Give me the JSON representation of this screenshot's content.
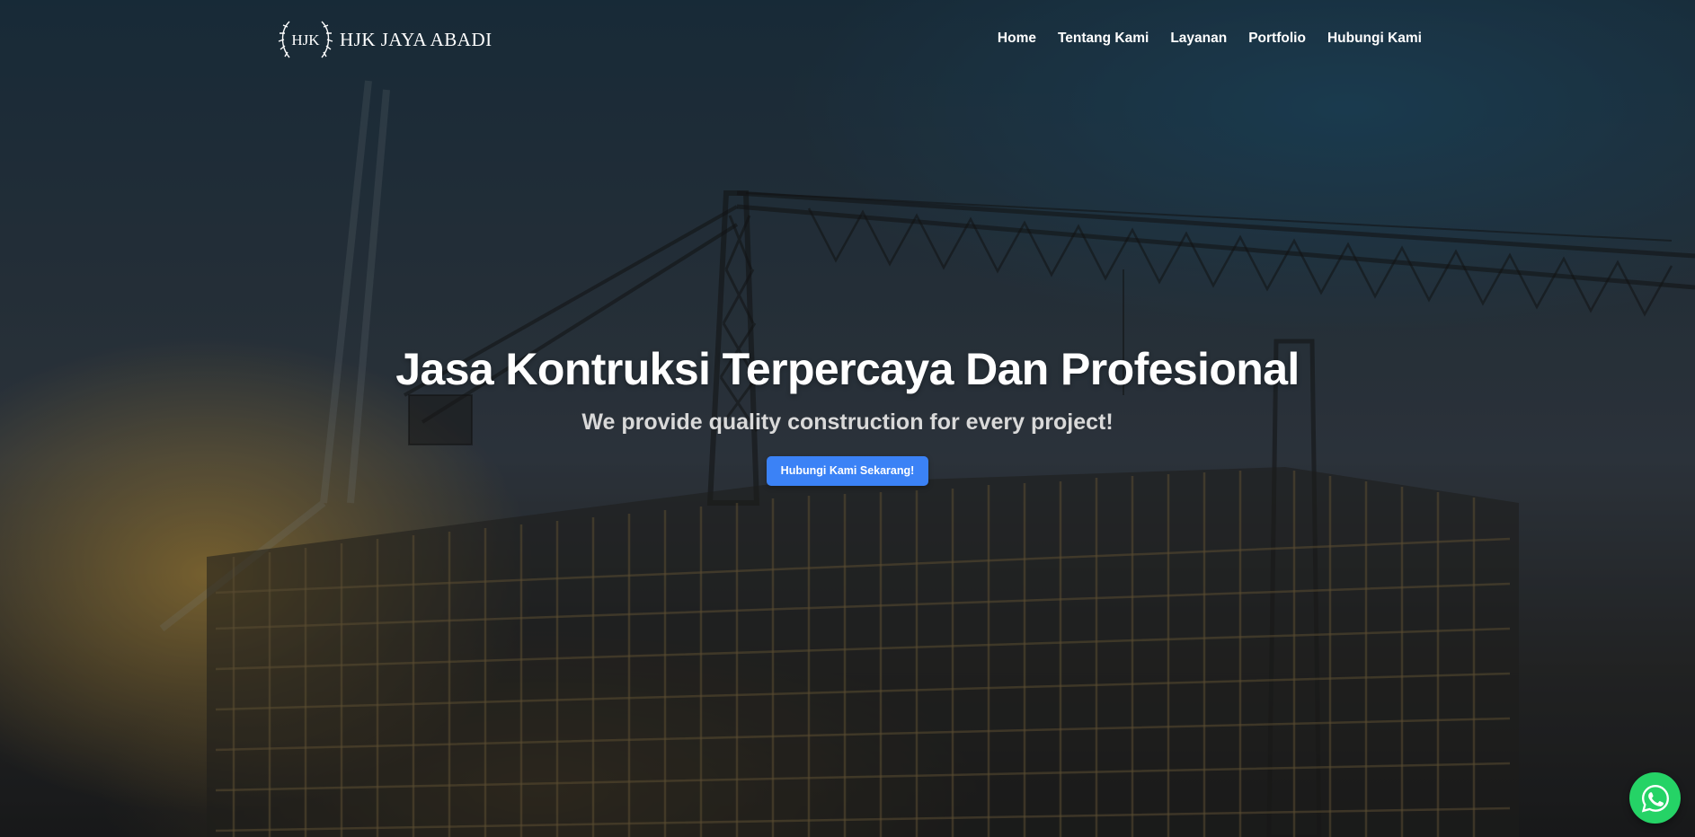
{
  "brand": {
    "logo_monogram": "HJK",
    "name": "HJK JAYA ABADI"
  },
  "nav": {
    "items": [
      {
        "label": "Home"
      },
      {
        "label": "Tentang Kami"
      },
      {
        "label": "Layanan"
      },
      {
        "label": "Portfolio"
      },
      {
        "label": "Hubungi Kami"
      }
    ]
  },
  "hero": {
    "title": "Jasa Kontruksi Terpercaya Dan Profesional",
    "subtitle": "We provide quality construction for every project!",
    "cta_label": "Hubungi Kami Sekarang!",
    "background_image": "construction-site-crane-scaffolding"
  },
  "floating": {
    "whatsapp_icon": "whatsapp-icon"
  },
  "colors": {
    "cta": "#3b82f6",
    "whatsapp": "#25d366",
    "text": "#ffffff",
    "subtitle": "#d9d9d9"
  }
}
